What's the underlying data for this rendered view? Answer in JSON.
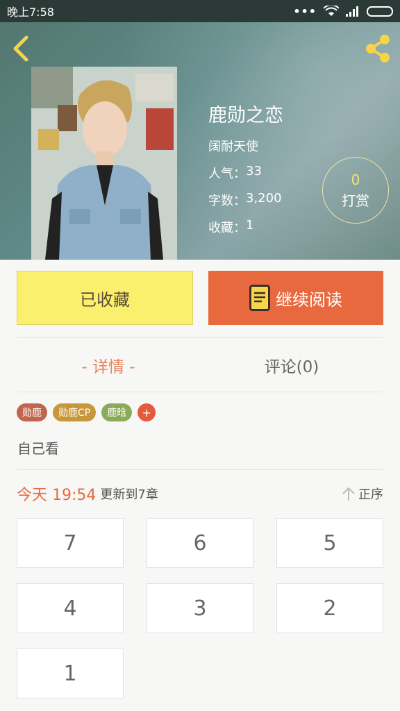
{
  "status_bar": {
    "time": "晚上7:58"
  },
  "book": {
    "title": "鹿勋之恋",
    "author": "阔耐天使",
    "popularity_label": "人气：",
    "popularity": "33",
    "words_label": "字数：",
    "words": "3,200",
    "favorites_label": "收藏：",
    "favorites": "1"
  },
  "reward": {
    "count": "0",
    "label": "打赏"
  },
  "actions": {
    "favorite_label": "已收藏",
    "read_label": "继续阅读"
  },
  "tabs": {
    "detail": "- 详情 -",
    "comment": "评论(0)"
  },
  "tags": [
    {
      "label": "勋鹿",
      "color": "#c0664f"
    },
    {
      "label": "勋鹿CP",
      "color": "#c8973a"
    },
    {
      "label": "鹿晗",
      "color": "#8cab5a"
    }
  ],
  "tag_add": "+",
  "summary": "自己看",
  "update": {
    "time": "今天 19:54",
    "text": "更新到7章",
    "sort_label": "正序"
  },
  "chapters": [
    "7",
    "6",
    "5",
    "4",
    "3",
    "2",
    "1"
  ],
  "colors": {
    "accent": "#e8693e",
    "favorite_bg": "#faf06e",
    "reward_count": "#f6e36c"
  }
}
